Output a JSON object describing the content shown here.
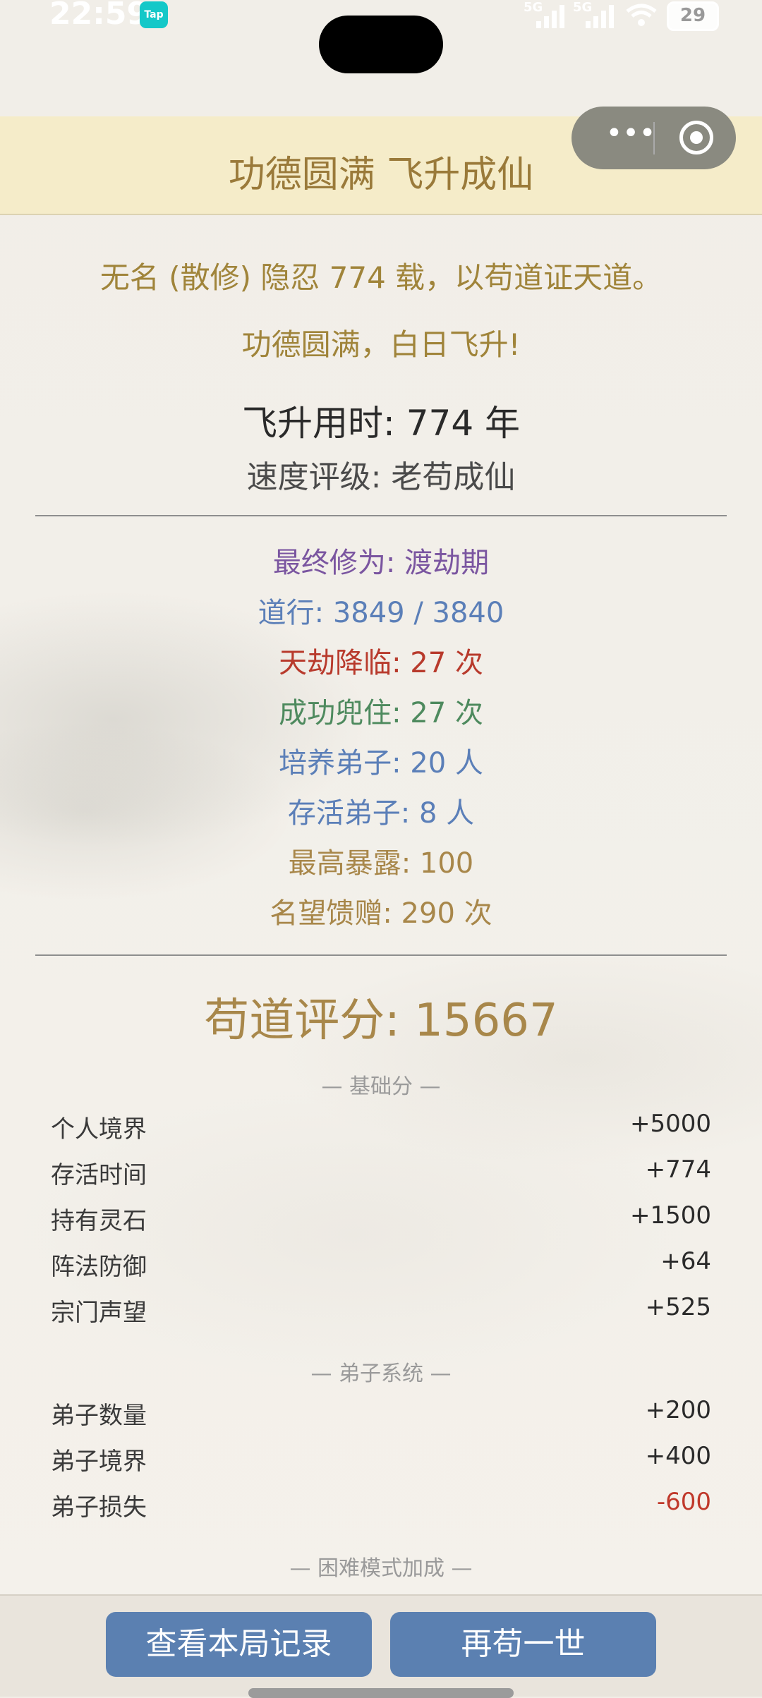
{
  "status_bar": {
    "time": "22:59",
    "app_badge": "Tap",
    "network_1": "5G",
    "network_2": "5G",
    "battery": "29"
  },
  "header": {
    "title": "功德圆满 飞升成仙"
  },
  "summary": {
    "intro": "无名 (散修) 隐忍 774 载，以苟道证天道。",
    "ascend": "功德圆满，白日飞升!",
    "use_time": "飞升用时: 774 年",
    "speed_rating": "速度评级: 老苟成仙"
  },
  "stats": [
    {
      "text": "最终修为: 渡劫期",
      "color": "#7a55a0"
    },
    {
      "text": "道行: 3849 / 3840",
      "color": "#5b7fb8"
    },
    {
      "text": "天劫降临: 27 次",
      "color": "#b83a2c"
    },
    {
      "text": "成功兜住: 27 次",
      "color": "#4e8a5e"
    },
    {
      "text": "培养弟子: 20 人",
      "color": "#5b7fb8"
    },
    {
      "text": "存活弟子: 8 人",
      "color": "#5b7fb8"
    },
    {
      "text": "最高暴露: 100",
      "color": "#a8874a"
    },
    {
      "text": "名望馈赠: 290 次",
      "color": "#a8874a"
    }
  ],
  "score": {
    "text": "苟道评分: 15667"
  },
  "sections": {
    "base": "— 基础分 —",
    "disciple": "— 弟子系统 —",
    "hard": "— 困难模式加成 —"
  },
  "base_rows": [
    {
      "label": "个人境界",
      "value": "+5000"
    },
    {
      "label": "存活时间",
      "value": "+774"
    },
    {
      "label": "持有灵石",
      "value": "+1500"
    },
    {
      "label": "阵法防御",
      "value": "+64"
    },
    {
      "label": "宗门声望",
      "value": "+525"
    }
  ],
  "disciple_rows": [
    {
      "label": "弟子数量",
      "value": "+200"
    },
    {
      "label": "弟子境界",
      "value": "+400"
    },
    {
      "label": "弟子损失",
      "value": "-600"
    }
  ],
  "buttons": {
    "view_record": "查看本局记录",
    "replay": "再苟一世"
  },
  "capsule": {
    "more_icon": "more-dots-icon",
    "close_icon": "target-icon"
  },
  "colors": {
    "accent": "#5b80b1",
    "gold": "#a8874a",
    "negative": "#c0392b"
  }
}
